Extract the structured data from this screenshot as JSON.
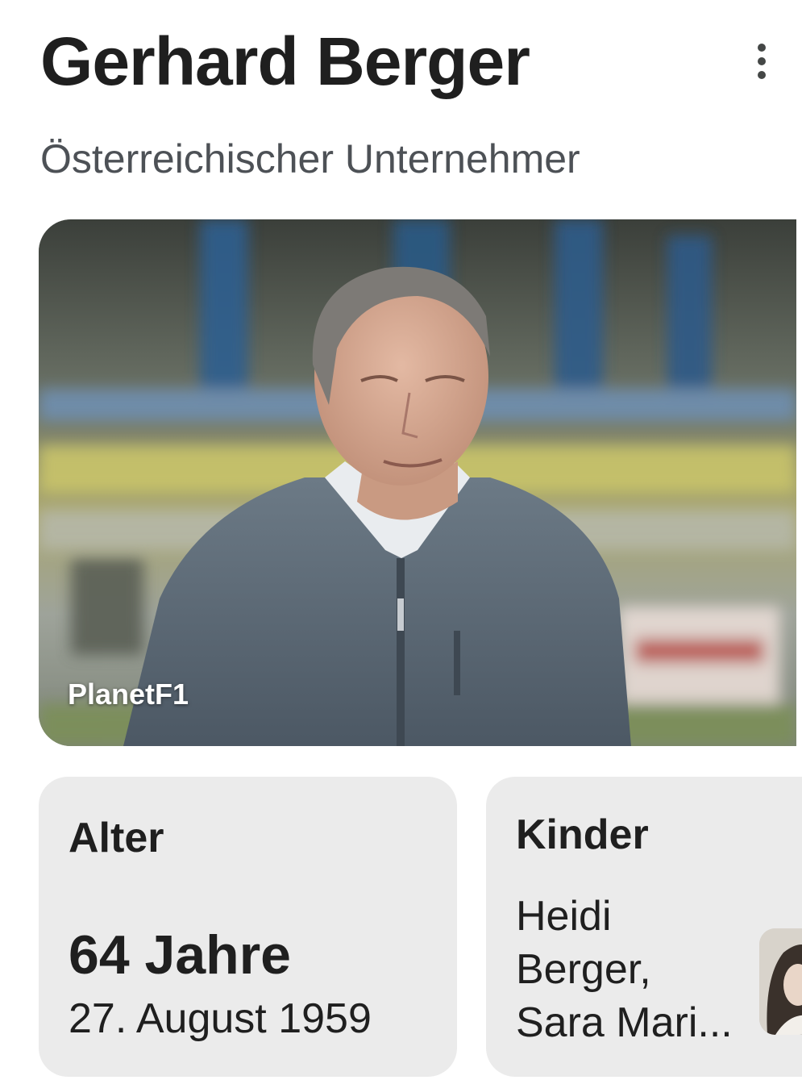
{
  "header": {
    "title": "Gerhard Berger",
    "subtitle": "Österreichischer Unternehmer",
    "menu_icon": "more-vert-icon"
  },
  "hero_image": {
    "credit": "PlanetF1"
  },
  "cards": {
    "age": {
      "label": "Alter",
      "value": "64 Jahre",
      "detail": "27. August 1959"
    },
    "children": {
      "label": "Kinder",
      "names_line1": "Heidi",
      "names_line2": "Berger,",
      "names_line3": "Sara Mari..."
    }
  },
  "colors": {
    "card_background": "#ebebeb",
    "title_text": "#1f1f1f",
    "subtitle_text": "#4d5156"
  }
}
